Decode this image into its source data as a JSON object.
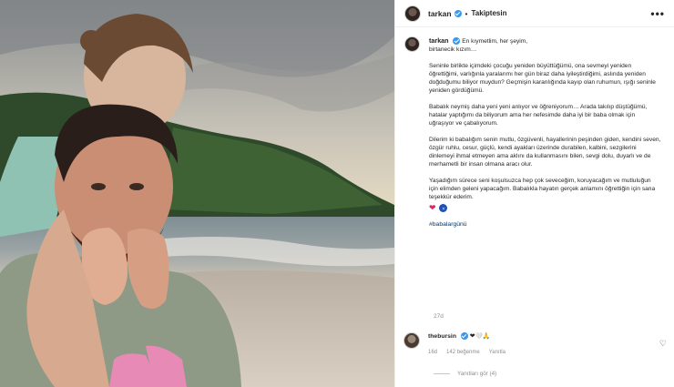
{
  "post": {
    "author": "tarkan",
    "dot": "•",
    "follow_label": "Takiptesin",
    "more_label": "•••",
    "caption_author": "tarkan",
    "caption_lines": [
      "En kıymetlim, her şeyim,\nbirtanecik kızım…",
      "Seninle birlikte içimdeki çocuğu yeniden büyüttüğümü, ona sevmeyi yeniden öğrettiğimi, varlığınla yaralarımı her gün biraz daha iyileştirdiğimi, aslında yeniden doğduğumu biliyor muydun? Geçmişin karanlığında kayıp olan ruhumun, ışığı seninle yeniden gördüğümü.",
      "Babalık neymiş daha yeni yeni anlıyor ve öğreniyorum… Arada takılıp düştüğümü, hatalar yaptığımı da biliyorum ama her nefesimde daha iyi bir baba olmak için uğraşıyor ve çabalıyorum.",
      "Dilerim ki babalığım senin mutlu, özgüvenli, hayallerinin peşinden giden, kendini seven, özgür ruhlu, cesur, güçlü, kendi ayakları üzerinde durabilen, kalbini, sezgilerini dinlemeyi ihmal etmeyen ama aklını da kullanmasını bilen, sevgi dolu, duyarlı ve de merhametli bir insan olmana aracı olur.",
      "Yaşadığım sürece seni koşulsuzca hep çok seveceğim, koruyacağım ve mutluluğun için elimden geleni yapacağım. Babalıkla hayatın gerçek anlamını öğrettiğin için sana teşekkür ederim."
    ],
    "emoji_heart": "❤",
    "hashtag": "#babalargünü",
    "age": "27d"
  },
  "comment": {
    "author": "thebursin",
    "text": "❤🤍🙏",
    "time": "16d",
    "likes": "142 beğenme",
    "reply_label": "Yanıtla",
    "heart_icon": "♡",
    "view_replies": "Yanıtları gör (4)"
  },
  "colors": {
    "link": "#00376b",
    "verified": "#3897f0",
    "muted": "#8e8e8e"
  }
}
